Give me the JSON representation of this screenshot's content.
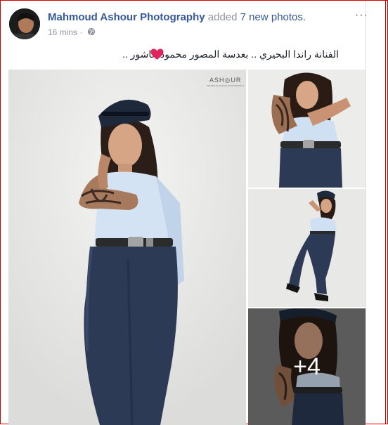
{
  "post": {
    "author": "Mahmoud Ashour Photography",
    "action": "added",
    "photo_count": "7 new photos.",
    "timestamp": "16 mins",
    "separator": "·",
    "privacy_icon": "globe-icon",
    "more_icon": "ellipsis-icon",
    "more_label": "···",
    "caption": "الفنانة راندا البحيري .. بعدسة المصور محمود عاشور ..",
    "emoji": "heart-icon"
  },
  "photos": {
    "watermark": "ASH◎UR",
    "watermark_sub": "MAHMOUD ASHOUR PHOTOGRAPHY",
    "more_overlay": "+4"
  },
  "colors": {
    "link": "#365899",
    "muted": "#90949c",
    "heart": "#e0245e",
    "frame": "#d40000"
  }
}
